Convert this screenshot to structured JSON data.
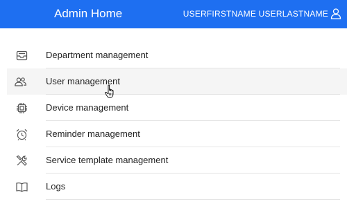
{
  "header": {
    "title": "Admin Home",
    "user_name": "USERFIRSTNAME USERLASTNAME",
    "user_icon": "user-icon",
    "background": "#1e6ff1"
  },
  "menu": {
    "items": [
      {
        "label": "Department management",
        "icon": "inbox-tray-icon"
      },
      {
        "label": "User management",
        "icon": "users-icon",
        "hovered": true
      },
      {
        "label": "Device management",
        "icon": "chip-icon"
      },
      {
        "label": "Reminder management",
        "icon": "alarm-clock-icon"
      },
      {
        "label": "Service template management",
        "icon": "tools-icon"
      },
      {
        "label": "Logs",
        "icon": "book-icon"
      }
    ]
  },
  "colors": {
    "hover_background": "#f5f5f5",
    "divider": "#e4e4e4"
  }
}
